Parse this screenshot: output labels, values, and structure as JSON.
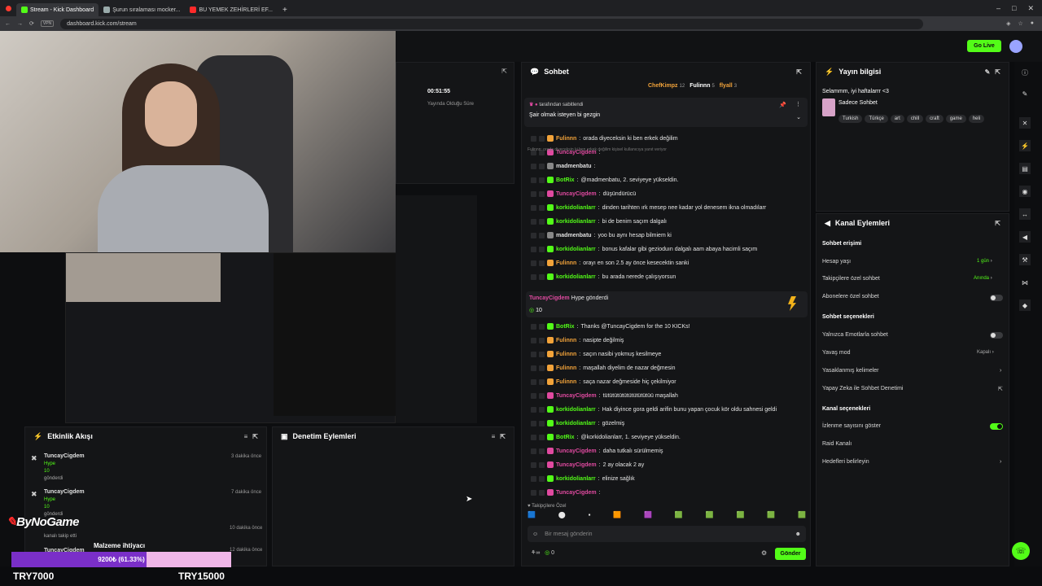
{
  "browser": {
    "tabs": [
      {
        "label": "Stream - Kick Dashboard",
        "color": "#53fc18",
        "active": true
      },
      {
        "label": "Şurun sıralaması mocker...",
        "color": "#9aa",
        "active": false
      },
      {
        "label": "BU YEMEK ZEHİRLERİ EF...",
        "color": "#ff2a2a",
        "active": false
      }
    ],
    "url": "dashboard.kick.com/stream",
    "vpn_label": "VPN"
  },
  "header": {
    "go_live_label": "Go Live"
  },
  "stream_stats": {
    "duration": "00:51:55",
    "duration_label": "Yayında Olduğu Süre"
  },
  "chat": {
    "title": "Sohbet",
    "top_gifters": [
      {
        "name": "ChefKimpz",
        "count": "12"
      },
      {
        "name": "Fulinnn",
        "count": "5"
      },
      {
        "name": "flyall",
        "count": "3"
      }
    ],
    "pinned": {
      "pinned_by_suffix": "tarafından sabitlendi",
      "message": "Şair olmak isteyen bi gezgin"
    },
    "reply_note": "Fulinnn: orada diyeceksin ki ben erkek değilim kişisel kullanıcıya yanıt veriyor",
    "messages": [
      {
        "user": "Fulinnn",
        "color": "orange",
        "text": "orada diyeceksin ki ben erkek değilim"
      },
      {
        "user": "TuncayCigdem",
        "color": "pink",
        "text": ""
      },
      {
        "user": "madmenbatu",
        "color": "white",
        "text": ""
      },
      {
        "user": "BotRix",
        "color": "bot",
        "text": "@madmenbatu, 2. seviyeye yükseldin."
      },
      {
        "user": "TuncayCigdem",
        "color": "pink",
        "text": "düşündürücü"
      },
      {
        "user": "korkidolianlarr",
        "color": "green",
        "text": "dinden tarihten ırk mesep nee kadar yol denesem ikna olmadılarr"
      },
      {
        "user": "korkidolianlarr",
        "color": "green",
        "text": "bi de benim saçım dalgalı"
      },
      {
        "user": "madmenbatu",
        "color": "white",
        "text": "yoo bu aynı hesap bilmiem ki"
      },
      {
        "user": "korkidolianlarr",
        "color": "green",
        "text": "bonus kafalar gibi gezioduın dalgalı aam abaya hacimli saçım"
      },
      {
        "user": "Fulinnn",
        "color": "orange",
        "text": "orayı en son 2.5 ay önce kesecektin sanki"
      },
      {
        "user": "korkidolianlarr",
        "color": "green",
        "text": "bu arada nerede çalışıyorsun"
      }
    ],
    "hype": {
      "user": "TuncayCigdem",
      "text": "Hype gönderdi",
      "amount": "10"
    },
    "messages2": [
      {
        "user": "BotRix",
        "color": "bot",
        "text": "Thanks @TuncayCigdem for the 10 KICKs!"
      },
      {
        "user": "Fulinnn",
        "color": "orange",
        "text": "nasipte değilmiş"
      },
      {
        "user": "Fulinnn",
        "color": "orange",
        "text": "saçın nasibi yokmuş kesilmeye"
      },
      {
        "user": "Fulinnn",
        "color": "orange",
        "text": "maşallah diyelim de nazar değmesin"
      },
      {
        "user": "Fulinnn",
        "color": "orange",
        "text": "saça nazar değmeside hiç çekilmiyor"
      },
      {
        "user": "TuncayCigdem",
        "color": "pink",
        "text": "tütütütütütütütütütüü maşallah"
      },
      {
        "user": "korkidolianlarr",
        "color": "green",
        "text": "Hak diyince gora geldi arifin bunu yapan çocuk kör oldu sahnesi geldi"
      },
      {
        "user": "korkidolianlarr",
        "color": "green",
        "text": "gözelmiş"
      },
      {
        "user": "BotRix",
        "color": "bot",
        "text": "@korkidolianlarr, 1. seviyeye yükseldin."
      },
      {
        "user": "TuncayCigdem",
        "color": "pink",
        "text": "daha tutkalı sürülmemiş"
      },
      {
        "user": "TuncayCigdem",
        "color": "pink",
        "text": "2 ay olacak 2 ay"
      },
      {
        "user": "korkidolianlarr",
        "color": "green",
        "text": "elinize sağlık"
      },
      {
        "user": "TuncayCigdem",
        "color": "pink",
        "text": ""
      }
    ],
    "follower_only_label": "Takipçilere Özel",
    "input_placeholder": "Bir mesaj gönderin",
    "send_label": "Gönder",
    "kicks_count": "0"
  },
  "stream_info": {
    "title": "Yayın bilgisi",
    "stream_title": "Selammm, iyi haftalarrr <3",
    "category": "Sadece Sohbet",
    "tags": [
      "Turkish",
      "Türkçe",
      "art",
      "chill",
      "craft",
      "game",
      "heli"
    ]
  },
  "channel_actions": {
    "title": "Kanal Eylemleri",
    "section_chat_access": "Sohbet erişimi",
    "account_age_label": "Hesap yaşı",
    "account_age_value": "1 gün",
    "follower_chat_label": "Takipçilere özel sohbet",
    "follower_chat_value": "Anında",
    "sub_chat_label": "Abonelere özel sohbet",
    "section_chat_options": "Sohbet seçenekleri",
    "emote_only_label": "Yalnızca Emotlarla sohbet",
    "slow_mode_label": "Yavaş mod",
    "slow_mode_value": "Kapalı",
    "banned_words_label": "Yasaklanmış kelimeler",
    "ai_moderation_label": "Yapay Zeka ile Sohbet Denetimi",
    "section_channel_options": "Kanal seçenekleri",
    "show_viewers_label": "İzlenme sayısını göster",
    "raid_label": "Raid Kanalı",
    "host_label": "Hedefleri belirleyin"
  },
  "activity": {
    "title": "Etkinlik Akışı",
    "events": [
      {
        "user": "TuncayCigdem",
        "type": "Hype",
        "amount": "10",
        "action": "gönderdi",
        "time": "3 dakika önce"
      },
      {
        "user": "TuncayCigdem",
        "type": "Hype",
        "amount": "10",
        "action": "gönderdi",
        "time": "7 dakika önce"
      },
      {
        "user": "",
        "type": "",
        "amount": "",
        "action": "kanalı takip etti",
        "time": "10 dakika önce"
      },
      {
        "user": "TuncayCigdem",
        "type": "",
        "amount": "",
        "action": "",
        "time": "12 dakika önce"
      }
    ]
  },
  "moderation": {
    "title": "Denetim Eylemleri"
  },
  "overlay": {
    "brand": "ByNoGame",
    "goal_title": "Malzeme ihtiyacı",
    "goal_progress": "9200₺ (61.33%)",
    "goal_fraction": 0.6133,
    "goal_start": "TRY7000",
    "goal_end": "TRY15000"
  },
  "colors": {
    "accent": "#53fc18",
    "panel": "#141517",
    "bg": "#0b0c0e"
  }
}
